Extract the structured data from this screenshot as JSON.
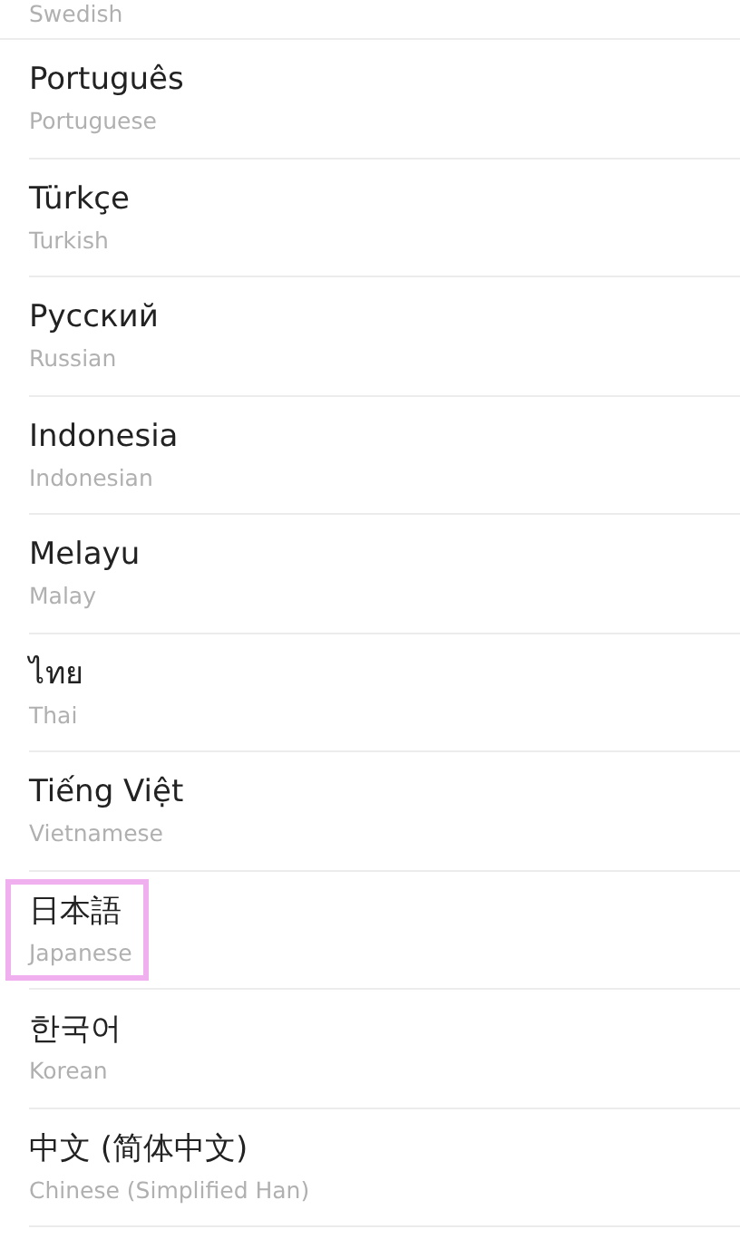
{
  "languages": [
    {
      "kind": "partial",
      "subtitle": "Swedish",
      "highlighted": false
    },
    {
      "kind": "full",
      "name": "Português",
      "subtitle": "Portuguese",
      "highlighted": false
    },
    {
      "kind": "full",
      "name": "Türkçe",
      "subtitle": "Turkish",
      "highlighted": false
    },
    {
      "kind": "full",
      "name": "Русский",
      "subtitle": "Russian",
      "highlighted": false
    },
    {
      "kind": "full",
      "name": "Indonesia",
      "subtitle": "Indonesian",
      "highlighted": false
    },
    {
      "kind": "full",
      "name": "Melayu",
      "subtitle": "Malay",
      "highlighted": false
    },
    {
      "kind": "full",
      "name": "ไทย",
      "subtitle": "Thai",
      "highlighted": false
    },
    {
      "kind": "full",
      "name": "Tiếng Việt",
      "subtitle": "Vietnamese",
      "highlighted": false
    },
    {
      "kind": "full",
      "name": "日本語",
      "subtitle": "Japanese",
      "highlighted": true
    },
    {
      "kind": "full",
      "name": "한국어",
      "subtitle": "Korean",
      "highlighted": false
    },
    {
      "kind": "full",
      "name": "中文 (简体中文)",
      "subtitle": "Chinese (Simplified Han)",
      "highlighted": false
    }
  ]
}
